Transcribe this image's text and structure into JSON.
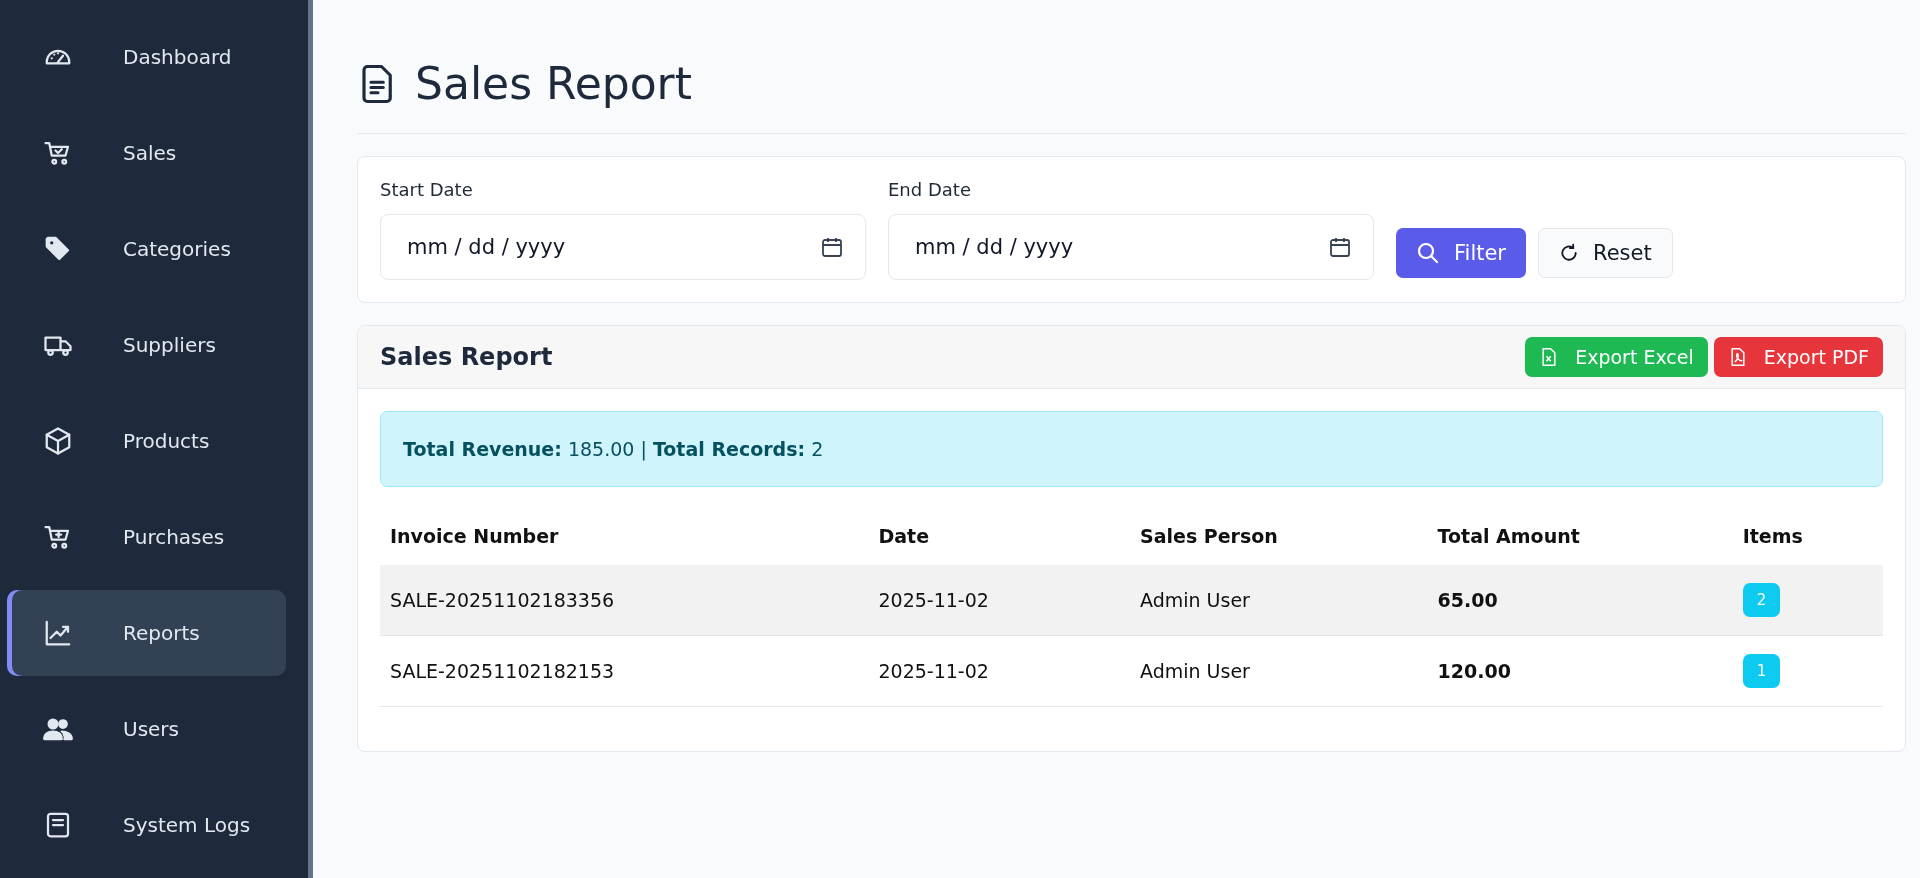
{
  "sidebar": {
    "items": [
      {
        "label": "Dashboard",
        "kind": "gauge",
        "selected": false
      },
      {
        "label": "Sales",
        "kind": "cart-check",
        "selected": false
      },
      {
        "label": "Categories",
        "kind": "tag",
        "selected": false
      },
      {
        "label": "Suppliers",
        "kind": "truck",
        "selected": false
      },
      {
        "label": "Products",
        "kind": "box",
        "selected": false
      },
      {
        "label": "Purchases",
        "kind": "cart-plus",
        "selected": false
      },
      {
        "label": "Reports",
        "kind": "graph",
        "selected": true
      },
      {
        "label": "Users",
        "kind": "people",
        "selected": false
      },
      {
        "label": "System Logs",
        "kind": "list",
        "selected": false
      }
    ]
  },
  "page_title": "Sales Report",
  "filters": {
    "fields": [
      {
        "label": "Start Date",
        "placeholder": "mm / dd / yyyy"
      },
      {
        "label": "End Date",
        "placeholder": "mm / dd / yyyy"
      }
    ],
    "buttons": [
      {
        "label": "Filter",
        "kind": "primary"
      },
      {
        "label": "Reset",
        "kind": "secondary"
      }
    ]
  },
  "report": {
    "title": "Sales Report",
    "exports": [
      {
        "label": "Export Excel",
        "kind": "excel"
      },
      {
        "label": "Export PDF",
        "kind": "pdf"
      }
    ],
    "summary": "**Total Revenue:** 185.00 | **Total Records:** 2",
    "table": {
      "columns": [
        "Invoice Number",
        "Date",
        "Sales Person",
        "Total Amount",
        "Items"
      ],
      "rows": [
        {
          "invoice": "SALE-20251102183356",
          "date": "2025-11-02",
          "person": "Admin User",
          "amount": "65.00",
          "items": "2"
        },
        {
          "invoice": "SALE-20251102182153",
          "date": "2025-11-02",
          "person": "Admin User",
          "amount": "120.00",
          "items": "1"
        }
      ]
    }
  }
}
